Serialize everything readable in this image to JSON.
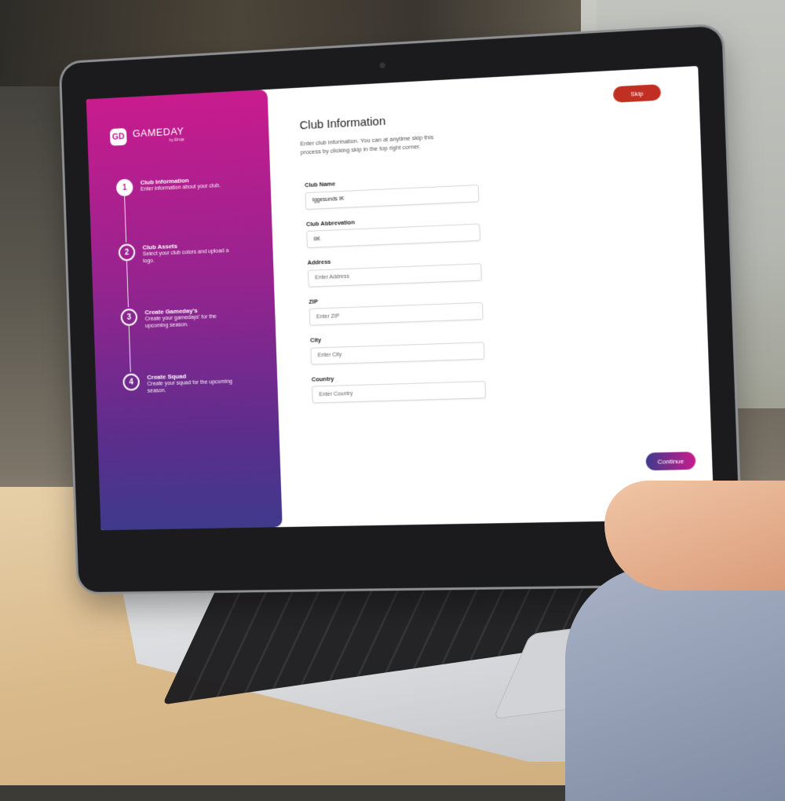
{
  "app": {
    "logo_mark": "GD",
    "name": "GAMEDAY",
    "tagline": "by Elroja"
  },
  "steps": [
    {
      "number": "1",
      "title": "Club Information",
      "description": "Enter information about your club."
    },
    {
      "number": "2",
      "title": "Club Assets",
      "description": "Select your club colors and upload a logo."
    },
    {
      "number": "3",
      "title": "Create Gameday's",
      "description": "Create your gamedays' for the upcoming season."
    },
    {
      "number": "4",
      "title": "Create Squad",
      "description": "Create your squad for the upcoming season."
    }
  ],
  "header": {
    "skip_label": "Skip",
    "title": "Club Information",
    "description": "Enter club information. You can at anytime skip this process by clicking skip in the top right corner."
  },
  "form": {
    "fields": [
      {
        "label": "Club Name",
        "value": "Iggesunds IK",
        "placeholder": ""
      },
      {
        "label": "Club Abbrevation",
        "value": "IIK",
        "placeholder": ""
      },
      {
        "label": "Address",
        "value": "",
        "placeholder": "Enter Address"
      },
      {
        "label": "ZIP",
        "value": "",
        "placeholder": "Enter ZIP"
      },
      {
        "label": "City",
        "value": "",
        "placeholder": "Enter City"
      },
      {
        "label": "Country",
        "value": "",
        "placeholder": "Enter Country"
      }
    ],
    "continue_label": "Continue"
  },
  "colors": {
    "sidebar_top": "#c91b8e",
    "sidebar_bottom": "#3f3a8c",
    "skip": "#c12f22"
  }
}
